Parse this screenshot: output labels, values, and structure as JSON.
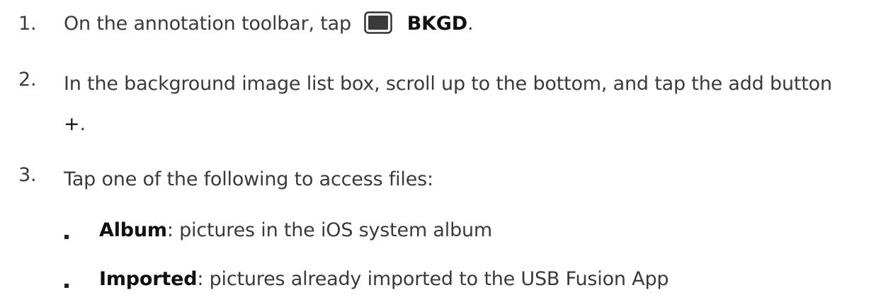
{
  "steps": [
    {
      "number": "1.",
      "before": "On the annotation toolbar, tap",
      "icon": "background-panel-icon",
      "label": "BKGD",
      "after": "."
    },
    {
      "number": "2.",
      "text": "In the background image list box, scroll up to the bottom, and tap the add button",
      "symbol": "+",
      "after": "."
    },
    {
      "number": "3.",
      "text": "Tap one of the following to access files:"
    }
  ],
  "options": [
    {
      "label": "Album",
      "description": ": pictures in the iOS system album"
    },
    {
      "label": "Imported",
      "description": ": pictures already imported to the USB Fusion App"
    }
  ],
  "colors": {
    "text": "#3a3a3a",
    "icon_fill": "#333333",
    "icon_border": "#333333"
  }
}
